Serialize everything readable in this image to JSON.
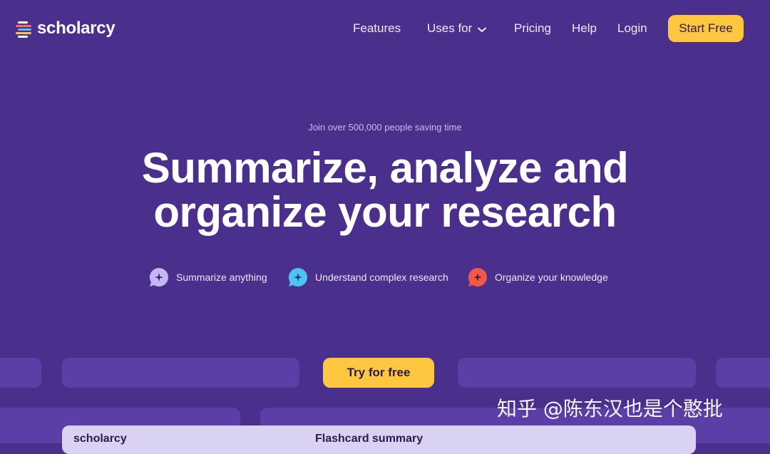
{
  "nav": {
    "logo": "scholarcy",
    "links": [
      "Features",
      "Uses for",
      "Pricing",
      "Help",
      "Login"
    ],
    "cta": "Start Free"
  },
  "hero": {
    "eyebrow": "Join over 500,000 people saving time",
    "headline_line1": "Summarize, analyze and",
    "headline_line2": "organize your research",
    "features": [
      {
        "label": "Summarize anything",
        "icon": "sparkle-chat-icon",
        "color": "#c6b6f2"
      },
      {
        "label": "Understand complex research",
        "icon": "sparkle-chat-icon",
        "color": "#4cc3f2"
      },
      {
        "label": "Organize your knowledge",
        "icon": "sparkle-chat-icon",
        "color": "#f0584a"
      }
    ],
    "try_button": "Try for free"
  },
  "preview": {
    "logo": "scholarcy",
    "title": "Flashcard summary"
  },
  "watermark": "知乎 @陈东汉也是个憨批",
  "colors": {
    "background": "#4a2f8c",
    "accent": "#ffc63f",
    "strip": "#5c3fa6"
  }
}
